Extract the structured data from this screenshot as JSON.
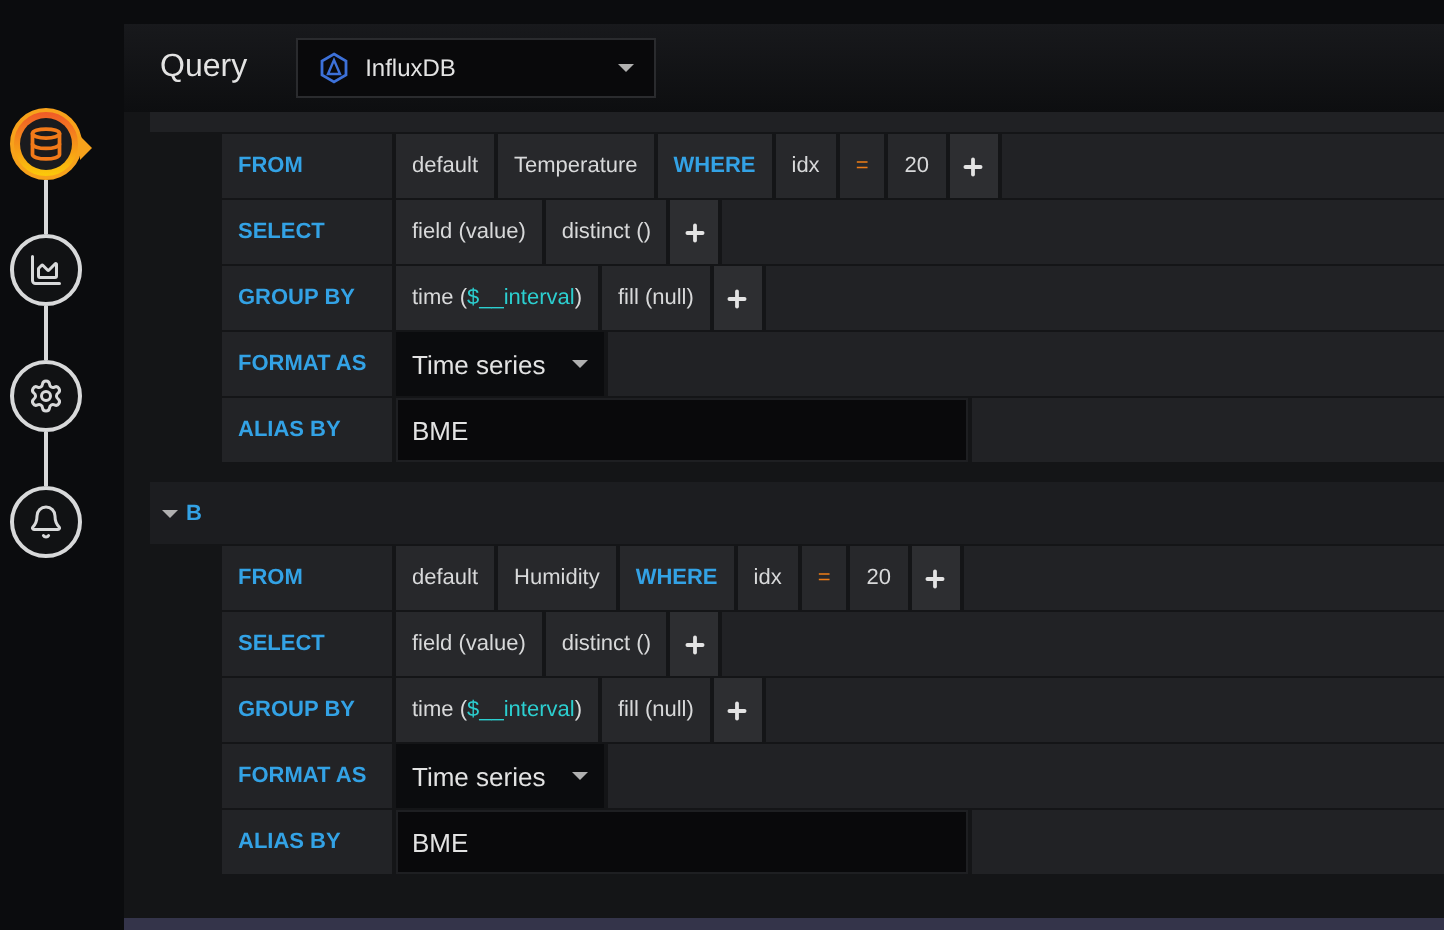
{
  "steps": [
    {
      "kind": "queries",
      "selected": true
    },
    {
      "kind": "visualization",
      "selected": false
    },
    {
      "kind": "general",
      "selected": false
    },
    {
      "kind": "alert",
      "selected": false
    }
  ],
  "header": {
    "title": "Query",
    "datasource": "InfluxDB"
  },
  "queries": [
    {
      "rows": [
        {
          "label": "FROM",
          "kind": "segments",
          "segments": [
            {
              "kind": "value",
              "parts": [
                {
                  "text": "default"
                }
              ]
            },
            {
              "kind": "value",
              "parts": [
                {
                  "text": "Temperature"
                }
              ]
            },
            {
              "kind": "keyword",
              "parts": [
                {
                  "text": "WHERE"
                }
              ]
            },
            {
              "kind": "value",
              "parts": [
                {
                  "text": "idx"
                }
              ]
            },
            {
              "kind": "operator",
              "parts": [
                {
                  "text": "="
                }
              ]
            },
            {
              "kind": "value",
              "parts": [
                {
                  "text": "20"
                }
              ]
            },
            {
              "kind": "add"
            }
          ]
        },
        {
          "label": "SELECT",
          "kind": "segments",
          "segments": [
            {
              "kind": "value",
              "parts": [
                {
                  "text": "field (value)"
                }
              ]
            },
            {
              "kind": "value",
              "parts": [
                {
                  "text": "distinct ()"
                }
              ]
            },
            {
              "kind": "add"
            }
          ]
        },
        {
          "label": "GROUP BY",
          "kind": "segments",
          "segments": [
            {
              "kind": "value",
              "parts": [
                {
                  "text": "time ("
                },
                {
                  "text": "$__interval",
                  "variable": true
                },
                {
                  "text": ")"
                }
              ]
            },
            {
              "kind": "value",
              "parts": [
                {
                  "text": "fill (null)"
                }
              ]
            },
            {
              "kind": "add"
            }
          ]
        },
        {
          "label": "FORMAT AS",
          "kind": "select",
          "value": "Time series"
        },
        {
          "label": "ALIAS BY",
          "kind": "input",
          "value": "BME"
        }
      ]
    },
    {
      "letter": "B",
      "expanded": true,
      "rows": [
        {
          "label": "FROM",
          "kind": "segments",
          "segments": [
            {
              "kind": "value",
              "parts": [
                {
                  "text": "default"
                }
              ]
            },
            {
              "kind": "value",
              "parts": [
                {
                  "text": "Humidity"
                }
              ]
            },
            {
              "kind": "keyword",
              "parts": [
                {
                  "text": "WHERE"
                }
              ]
            },
            {
              "kind": "value",
              "parts": [
                {
                  "text": "idx"
                }
              ]
            },
            {
              "kind": "operator",
              "parts": [
                {
                  "text": "="
                }
              ]
            },
            {
              "kind": "value",
              "parts": [
                {
                  "text": "20"
                }
              ]
            },
            {
              "kind": "add"
            }
          ]
        },
        {
          "label": "SELECT",
          "kind": "segments",
          "segments": [
            {
              "kind": "value",
              "parts": [
                {
                  "text": "field (value)"
                }
              ]
            },
            {
              "kind": "value",
              "parts": [
                {
                  "text": "distinct ()"
                }
              ]
            },
            {
              "kind": "add"
            }
          ]
        },
        {
          "label": "GROUP BY",
          "kind": "segments",
          "segments": [
            {
              "kind": "value",
              "parts": [
                {
                  "text": "time ("
                },
                {
                  "text": "$__interval",
                  "variable": true
                },
                {
                  "text": ")"
                }
              ]
            },
            {
              "kind": "value",
              "parts": [
                {
                  "text": "fill (null)"
                }
              ]
            },
            {
              "kind": "add"
            }
          ]
        },
        {
          "label": "FORMAT AS",
          "kind": "select",
          "value": "Time series"
        },
        {
          "label": "ALIAS BY",
          "kind": "input",
          "value": "BME"
        }
      ]
    }
  ]
}
